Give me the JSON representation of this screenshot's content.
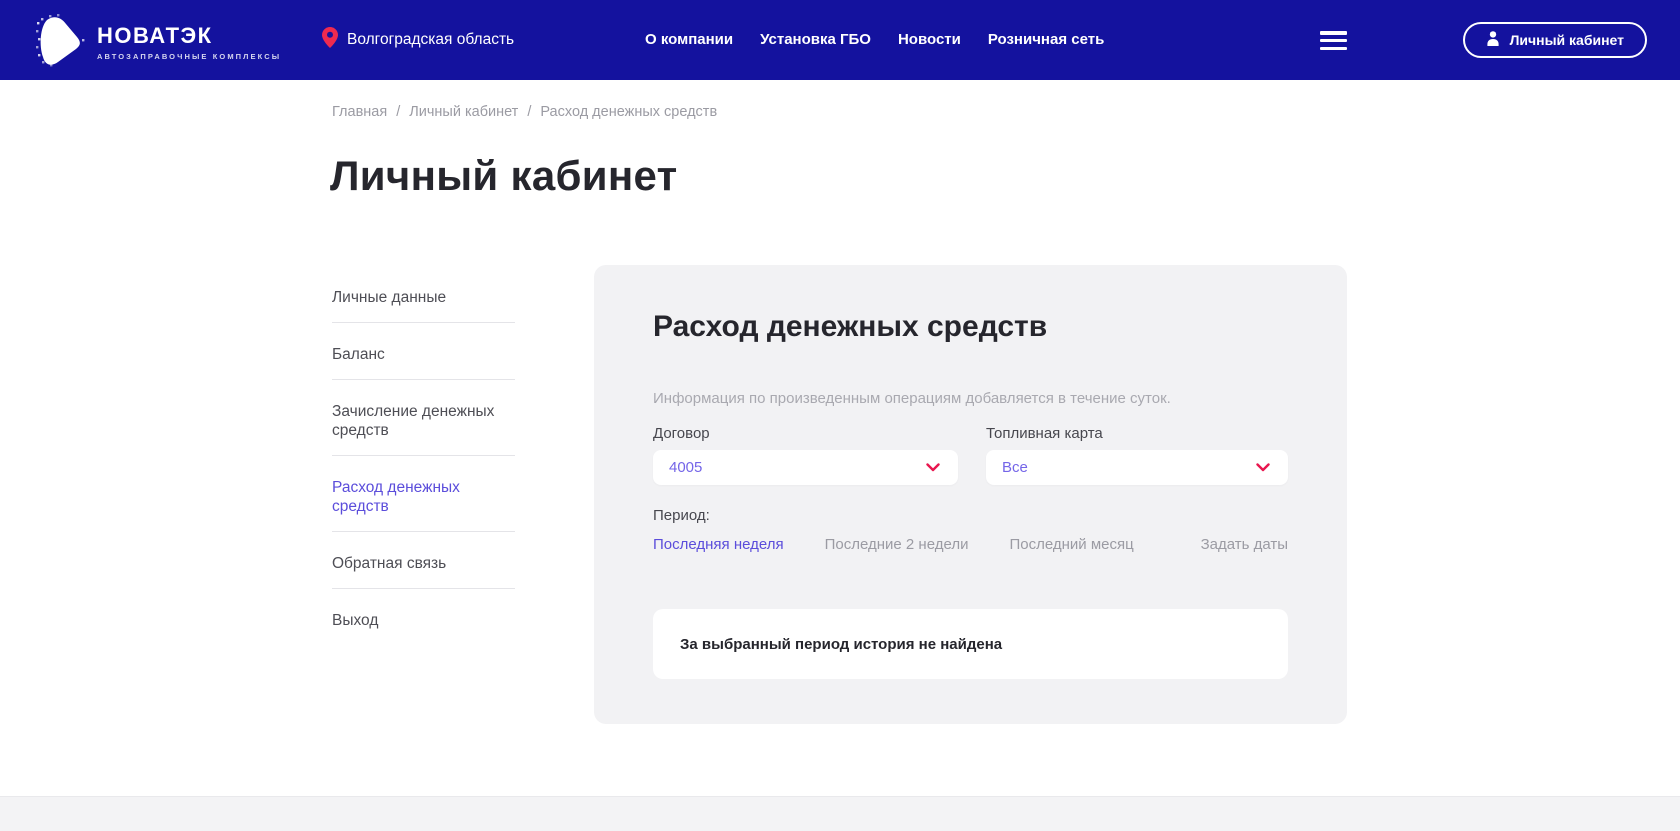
{
  "colors": {
    "header_bg": "#14129e",
    "accent_red": "#e8174f",
    "accent_purple": "#5b4ddb",
    "select_value_purple": "#7465e8",
    "card_bg": "#f2f2f4",
    "text_dark": "#26262d",
    "text_gray": "#9b9ba3"
  },
  "header": {
    "logo": {
      "title": "НОВАТЭК",
      "subtitle": "АВТОЗАПРАВОЧНЫЕ КОМПЛЕКСЫ"
    },
    "location": "Волгоградская область",
    "nav": [
      {
        "label": "О компании"
      },
      {
        "label": "Установка ГБО"
      },
      {
        "label": "Новости"
      },
      {
        "label": "Розничная сеть"
      }
    ],
    "account_button": "Личный кабинет"
  },
  "breadcrumb": {
    "separator": "/",
    "items": [
      {
        "label": "Главная"
      },
      {
        "label": "Личный кабинет"
      },
      {
        "label": "Расход денежных средств"
      }
    ]
  },
  "page_title": "Личный кабинет",
  "sidebar": {
    "items": [
      {
        "label": "Личные данные"
      },
      {
        "label": "Баланс"
      },
      {
        "label": "Зачисление денежных средств"
      },
      {
        "label": "Расход денежных средств"
      },
      {
        "label": "Обратная связь"
      },
      {
        "label": "Выход"
      }
    ]
  },
  "panel": {
    "title": "Расход денежных средств",
    "note": "Информация по произведенным операциям добавляется в течение суток.",
    "contract": {
      "label": "Договор",
      "value": "4005"
    },
    "fuel_card": {
      "label": "Топливная карта",
      "value": "Все"
    },
    "period": {
      "label": "Период:",
      "options": [
        {
          "label": "Последняя неделя"
        },
        {
          "label": "Последние 2 недели"
        },
        {
          "label": "Последний месяц"
        },
        {
          "label": "Задать даты"
        }
      ]
    },
    "empty_message": "За выбранный период история не найдена"
  }
}
